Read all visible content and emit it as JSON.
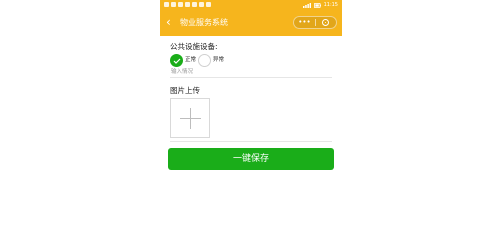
{
  "nav": {
    "title": "物业服务系统",
    "back_icon": "chevron-left-icon",
    "more_icon": "more-dots-icon",
    "close_icon": "target-close-icon",
    "background_color": "#f6b51d"
  },
  "status_bar": {
    "time": "11:15"
  },
  "form": {
    "facility_label": "公共设施设备:",
    "options": [
      {
        "label": "正常",
        "checked": true
      },
      {
        "label": "异常",
        "checked": false
      }
    ],
    "remark_placeholder": "输入情况",
    "upload_label": "图片上传",
    "upload_icon": "plus-icon"
  },
  "save_button": {
    "label": "一键保存",
    "color": "#1aad19"
  }
}
